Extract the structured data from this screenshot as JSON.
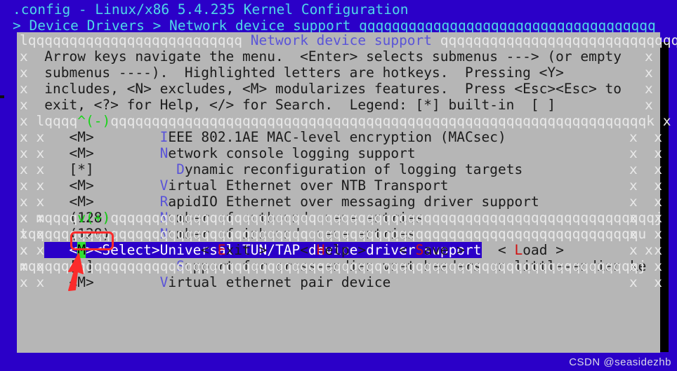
{
  "window": {
    "title": ".config - Linux/x86 5.4.235 Kernel Configuration",
    "breadcrumb": "> Device Drivers > Network device support ",
    "breadcrumb_fill": "qqqqqqqqqqqqqqqqqqqqqqqqqqqqqqqqqqqq",
    "bg_color": "#2b00c8",
    "title_color": "#4fd8e8"
  },
  "dialog": {
    "title": "Network device support",
    "top_left_corner": "l",
    "top_fill_left": "qqqqqqqqqqqqqqqqqqqqqqqqqq",
    "top_fill_right": "qqqqqqqqqqqqqqqqqqqqqqqqqqqqq",
    "top_right_corner": "k",
    "side_char": "x",
    "bg_color": "#b6b6b6",
    "title_color": "#5a54d8"
  },
  "help": {
    "lines": [
      "Arrow keys navigate the menu.  <Enter> selects submenus ---> (or empty",
      "submenus ----).  Highlighted letters are hotkeys.  Pressing <Y>",
      "includes, <N> excludes, <M> modularizes features.  Press <Esc><Esc> to",
      "exit, <?> for Help, </> for Search.  Legend: [*] built-in  [ ]"
    ]
  },
  "menu_box": {
    "top_corner": "l",
    "top_fill_a": "qqqq",
    "scroll_up": "^(-)",
    "top_fill_b": "qqqqqqqqqqqqqqqqqqqqqqqqqqqqqqqqqqqqqqqqqqqqqqqqqqqqqqqqqqqqqqqqq",
    "top_right": "k",
    "bottom_corner": "m",
    "bottom_fill_a": "qqqq",
    "scroll_down": "v(+)",
    "bottom_fill_b": "qqqqqqqqqqqqqqqqqqqqqqqqqqqqqqqqqqqqqqqqqqqqqqqqqqqqqqqqqqqqqqqqqq",
    "bottom_right": "j",
    "side_char": "x"
  },
  "menu_items": [
    {
      "state": "<M>",
      "hotkey": "I",
      "label": "EEE 802.1AE MAC-level encryption (MACsec)",
      "indent": 0,
      "selected": false
    },
    {
      "state": "<M>",
      "hotkey": "N",
      "label": "etwork console logging support",
      "indent": 0,
      "selected": false
    },
    {
      "state": "[*]",
      "hotkey": "D",
      "label": "ynamic reconfiguration of logging targets",
      "indent": 2,
      "selected": false
    },
    {
      "state": "<M>",
      "hotkey": "V",
      "label": "irtual Ethernet over NTB Transport",
      "indent": 0,
      "selected": false
    },
    {
      "state": "<M>",
      "hotkey": "R",
      "label": "apidIO Ethernet over messaging driver support",
      "indent": 0,
      "selected": false
    },
    {
      "state": "(128)",
      "hotkey": "N",
      "label": "umber of outbound queue entries",
      "indent": 0,
      "selected": false
    },
    {
      "state": "(128)",
      "hotkey": "N",
      "label": "umber of inbound queue entries",
      "indent": 0,
      "selected": false
    },
    {
      "state": "<M>",
      "hotkey": "U",
      "label": "niversal TUN/TAP device driver support",
      "indent": 0,
      "selected": true,
      "cursor_char": "M"
    },
    {
      "state": "[ ]",
      "hotkey": "S",
      "label": "upport for cross-endian vnet headers on little-endian ke",
      "indent": 2,
      "selected": false
    },
    {
      "state": "<M>",
      "hotkey": "V",
      "label": "irtual ethernet pair device",
      "indent": 0,
      "selected": false
    }
  ],
  "footer": {
    "top_corner": "t",
    "top_fill": "qqqqqqqqqqqqqqqqqqqqqqqqqqqqqqqqqqqqqqqqqqqqqqqqqqqqqqqqqqqqqqqqqqqqqqqqqq",
    "top_right": "u",
    "bottom_corner": "m",
    "bottom_fill": "qqqqqqqqqqqqqqqqqqqqqqqqqqqqqqqqqqqqqqqqqqqqqqqqqqqqqqqqqqqqqqqqqqqqqqqqqq",
    "bottom_right": "j",
    "side_char": "x"
  },
  "buttons": [
    {
      "name": "select",
      "text": "<Select>",
      "selected": true,
      "prefix": "",
      "hot": "",
      "rest": ""
    },
    {
      "name": "exit",
      "text": "< Exit >",
      "selected": false,
      "prefix": "< ",
      "hot": "E",
      "rest": "xit >"
    },
    {
      "name": "help",
      "text": "< Help >",
      "selected": false,
      "prefix": "< ",
      "hot": "H",
      "rest": "elp >"
    },
    {
      "name": "save",
      "text": "< Save >",
      "selected": false,
      "prefix": "< ",
      "hot": "S",
      "rest": "ave >"
    },
    {
      "name": "load",
      "text": "< Load >",
      "selected": false,
      "prefix": "< ",
      "hot": "L",
      "rest": "oad >"
    }
  ],
  "annotations": {
    "highlight_box_color": "#fb2b2b",
    "arrow_color": "#fb2b2b",
    "target": "<M>"
  },
  "watermark": "CSDN @seasidezhb"
}
